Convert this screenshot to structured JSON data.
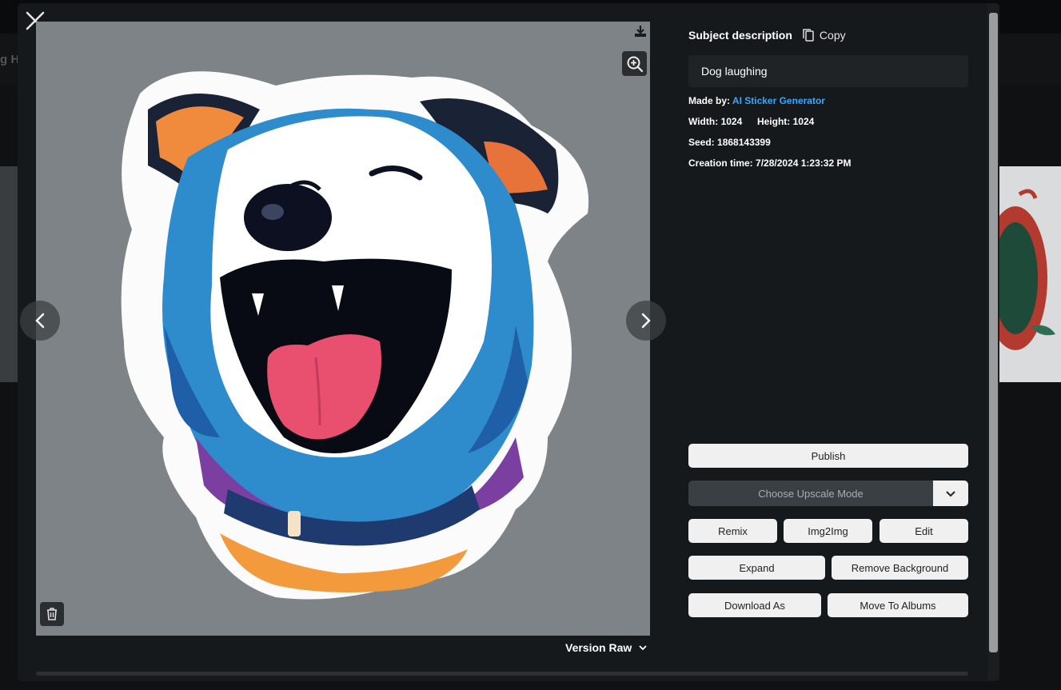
{
  "background": {
    "partial_text": "g H"
  },
  "image": {
    "alt": "Dog laughing sticker"
  },
  "version": {
    "label": "Version Raw"
  },
  "panel": {
    "subject_title": "Subject description",
    "copy_label": "Copy",
    "description": "Dog laughing",
    "made_by_label": "Made by:",
    "made_by_value": "AI Sticker Generator",
    "width_label": "Width:",
    "width_value": "1024",
    "height_label": "Height:",
    "height_value": "1024",
    "seed_label": "Seed:",
    "seed_value": "1868143399",
    "creation_label": "Creation time:",
    "creation_value": "7/28/2024 1:23:32 PM"
  },
  "actions": {
    "publish": "Publish",
    "upscale_placeholder": "Choose Upscale Mode",
    "remix": "Remix",
    "img2img": "Img2Img",
    "edit": "Edit",
    "expand": "Expand",
    "remove_background": "Remove Background",
    "download_as": "Download As",
    "move_to_albums": "Move To Albums"
  },
  "colors": {
    "modal_bg": "#16191b",
    "accent_link": "#3aa6ff",
    "button_bg": "#f0f0f0",
    "image_bg": "#7d8386"
  }
}
